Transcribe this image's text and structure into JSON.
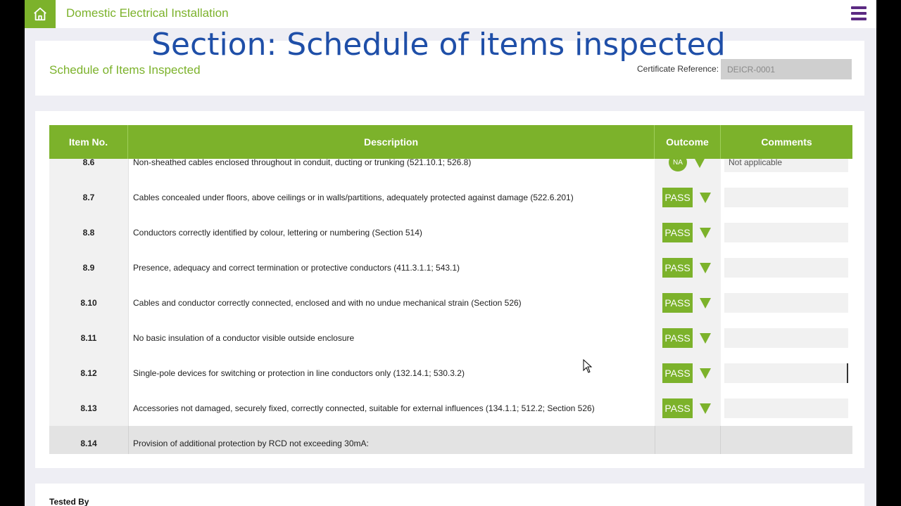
{
  "app": {
    "title": "Domestic Electrical Installation"
  },
  "overlay": {
    "title": "Section: Schedule of items inspected"
  },
  "section": {
    "title": "Schedule of Items Inspected",
    "certificate_label": "Certificate Reference:",
    "certificate_value": "DEICR-0001"
  },
  "table": {
    "headers": {
      "item": "Item No.",
      "description": "Description",
      "outcome": "Outcome",
      "comments": "Comments"
    },
    "partial_row": {
      "item": "8.6",
      "description": "Non-sheathed cables enclosed throughout in conduit, ducting or trunking (521.10.1; 526.8)",
      "outcome": "NA",
      "comment": "Not applicable"
    },
    "rows": [
      {
        "item": "8.7",
        "description": "Cables concealed under floors, above ceilings or in walls/partitions, adequately protected against damage (522.6.201)",
        "outcome": "PASS"
      },
      {
        "item": "8.8",
        "description": "Conductors correctly identified by colour, lettering or numbering (Section 514)",
        "outcome": "PASS"
      },
      {
        "item": "8.9",
        "description": "Presence, adequacy and correct termination or protective conductors (411.3.1.1; 543.1)",
        "outcome": "PASS"
      },
      {
        "item": "8.10",
        "description": "Cables and conductor correctly connected, enclosed and with no undue mechanical strain (Section 526)",
        "outcome": "PASS"
      },
      {
        "item": "8.11",
        "description": "No basic insulation of a conductor visible outside enclosure",
        "outcome": "PASS"
      },
      {
        "item": "8.12",
        "description": "Single-pole devices for switching or protection in line conductors only (132.14.1; 530.3.2)",
        "outcome": "PASS"
      },
      {
        "item": "8.13",
        "description": "Accessories not damaged, securely fixed, correctly connected, suitable for external influences (134.1.1; 512.2; Section 526)",
        "outcome": "PASS"
      }
    ],
    "group_row": {
      "item": "8.14",
      "description": "Provision of additional protection by RCD not exceeding 30mA:"
    }
  },
  "footer": {
    "tested_by": "Tested By"
  },
  "colors": {
    "accent": "#7cb22b",
    "menu": "#5b2a82",
    "overlay_text": "#1f4fa8"
  },
  "icons": {
    "home": "home-icon",
    "menu": "hamburger-menu-icon",
    "dropdown": "caret-down-icon",
    "cursor": "mouse-pointer-icon"
  }
}
